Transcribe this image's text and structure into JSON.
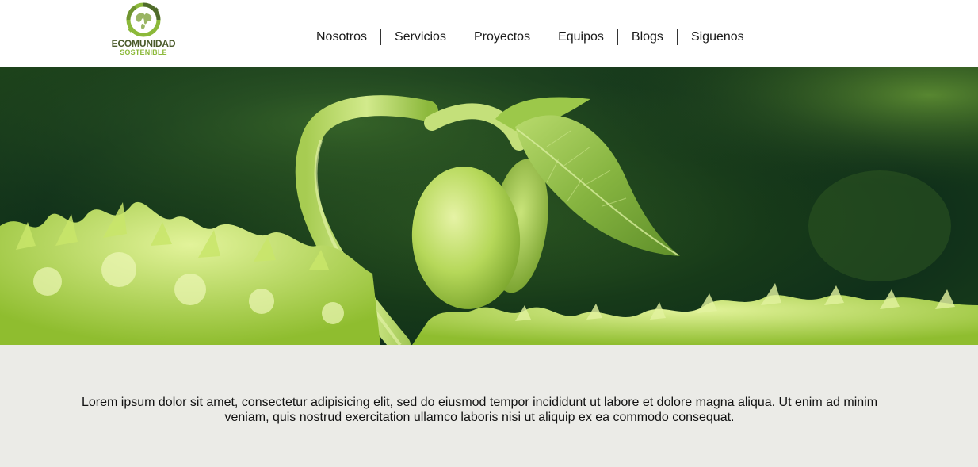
{
  "brand": {
    "name_line1": "ECOMUNIDAD",
    "name_line2": "SOSTENIBLE",
    "logo_icon": "globe-recycle-icon",
    "colors": {
      "dark": "#4a5a2a",
      "accent": "#8cb93a"
    }
  },
  "nav": {
    "items": [
      {
        "label": "Nosotros"
      },
      {
        "label": "Servicios"
      },
      {
        "label": "Proyectos"
      },
      {
        "label": "Equipos"
      },
      {
        "label": "Blogs"
      },
      {
        "label": "Siguenos"
      }
    ]
  },
  "hero": {
    "image": "seedling-sprout-image"
  },
  "intro": {
    "text": "Lorem ipsum dolor sit amet, consectetur adipisicing elit, sed do eiusmod tempor incididunt ut labore et dolore magna aliqua. Ut enim ad minim veniam, quis nostrud exercitation ullamco laboris nisi ut aliquip ex ea commodo consequat."
  },
  "colors": {
    "content_bg": "#ebebe7",
    "hero_dark": "#10301a",
    "leaf_green": "#9fcd3c"
  }
}
